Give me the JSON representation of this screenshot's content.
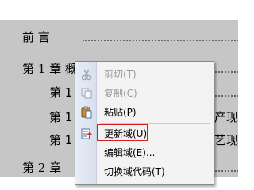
{
  "document": {
    "preface_text": "前     言",
    "chapter1_text": "第 1 章  概述",
    "sub1_text": "第 1",
    "sub2_text": "第 1",
    "sub2_tail": "产现",
    "sub3_text": "第 1",
    "sub3_tail": "艺现",
    "chapter2_text": "第 2 章"
  },
  "context_menu": {
    "items": [
      {
        "label": "剪切(T)",
        "enabled": false,
        "icon": "scissors-icon"
      },
      {
        "label": "复制(C)",
        "enabled": false,
        "icon": "copy-icon"
      },
      {
        "label": "粘贴(P)",
        "enabled": true,
        "icon": "paste-icon"
      },
      {
        "label": "更新域(U)",
        "enabled": true,
        "icon": "update-field-icon",
        "highlighted": true
      },
      {
        "label": "编辑域(E)...",
        "enabled": true,
        "icon": ""
      },
      {
        "label": "切换域代码(T)",
        "enabled": true,
        "icon": ""
      }
    ]
  },
  "colors": {
    "highlight": "#c6c6c6",
    "callout": "#d81f1f",
    "disabled_text": "#9a9a9a"
  }
}
